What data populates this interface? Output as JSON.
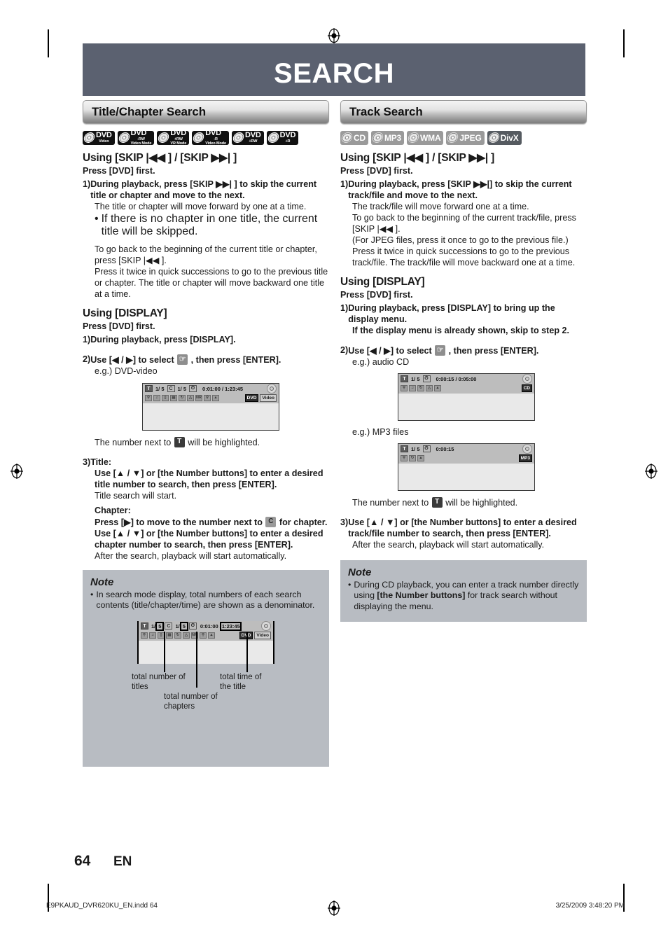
{
  "page": {
    "banner_title": "SEARCH",
    "page_number": "64",
    "language_code": "EN",
    "footer_file": "E9PKAUD_DVR620KU_EN.indd   64",
    "footer_date": "3/25/2009   3:48:20 PM",
    "banner_color": "#5b6170",
    "note_bg_color": "#b8bcc2"
  },
  "left": {
    "section_title": "Title/Chapter Search",
    "badges": [
      {
        "main": "DVD",
        "sub": "Video",
        "sub2": "",
        "style": "dark"
      },
      {
        "main": "DVD",
        "sub": "-RW",
        "sub2": "Video Mode",
        "style": "dark"
      },
      {
        "main": "DVD",
        "sub": "+RW",
        "sub2": "VR Mode",
        "style": "dark"
      },
      {
        "main": "DVD",
        "sub": "-R",
        "sub2": "Video Mode",
        "style": "dark"
      },
      {
        "main": "DVD",
        "sub": "+RW",
        "sub2": "",
        "style": "dark"
      },
      {
        "main": "DVD",
        "sub": "+R",
        "sub2": "",
        "style": "dark"
      }
    ],
    "skip_heading": "Using [SKIP |◀◀ ] / [SKIP ▶▶| ]",
    "skip_press_first": "Press [DVD] first.",
    "skip_step1_num": "1)",
    "skip_step1_text": "During playback, press [SKIP ▶▶| ] to skip the current title or chapter and move to the next.",
    "skip_step1_line2": "The title or chapter will move forward by one at a time.",
    "skip_step1_bullet": "If there is no chapter in one title, the current title will be skipped.",
    "skip_para1": "To go back to the beginning of the current title or chapter, press [SKIP |◀◀ ].",
    "skip_para2": "Press it twice in quick successions to go to the previous title or chapter. The title or chapter will move backward one title at a time.",
    "display_heading": "Using [DISPLAY]",
    "display_press_first": "Press [DVD] first.",
    "display_step1_num": "1)",
    "display_step1_text": "During playback, press [DISPLAY].",
    "display_step2_num": "2)",
    "display_step2_pre": "Use [◀ / ▶] to select",
    "display_step2_post": ", then press [ENTER].",
    "display_step2_eg": "e.g.) DVD-video",
    "highlight_pre": "The number next to",
    "highlight_post": "will be highlighted.",
    "step3_num": "3)",
    "step3_title_label": "Title:",
    "step3_title_text": "Use [▲ / ▼] or [the Number buttons] to enter a desired title number to search, then press [ENTER].",
    "step3_title_note": "Title search will start.",
    "step3_chapter_label": "Chapter:",
    "step3_chapter_pre": "Press [▶] to move to the number next to",
    "step3_chapter_post": "for chapter.",
    "step3_chapter_text": "Use [▲ / ▼] or [the Number buttons] to enter a desired chapter number to search, then press [ENTER].",
    "step3_after": "After the search, playback will start automatically.",
    "note_title": "Note",
    "note_item": "In search mode display, total numbers of each search contents (title/chapter/time) are shown as a denominator.",
    "callout_titles": "total number of titles",
    "callout_chapters": "total number of chapters",
    "callout_time": "total time of the title"
  },
  "right": {
    "section_title": "Track Search",
    "badges": [
      {
        "main": "CD",
        "style": "gray"
      },
      {
        "main": "MP3",
        "style": "gray"
      },
      {
        "main": "WMA",
        "style": "gray"
      },
      {
        "main": "JPEG",
        "style": "gray"
      },
      {
        "main": "DivX",
        "style": "dgray"
      }
    ],
    "skip_heading": "Using [SKIP |◀◀ ] / [SKIP ▶▶| ]",
    "skip_press_first": "Press [DVD] first.",
    "skip_step1_num": "1)",
    "skip_step1_text": "During playback, press [SKIP ▶▶|] to skip the current track/file and move to the next.",
    "skip_line2": "The track/file will move forward one at a time.",
    "skip_line3": "To go back to the beginning of the current track/file, press [SKIP |◀◀ ].",
    "skip_line4": "(For JPEG files, press it once to go to the previous file.)",
    "skip_line5": "Press it twice in quick successions to go to the previous track/file. The track/file will move backward one at a time.",
    "display_heading": "Using [DISPLAY]",
    "display_press_first": "Press [DVD] first.",
    "display_step1_num": "1)",
    "display_step1_text": "During playback, press [DISPLAY] to bring up the display menu.",
    "display_step1_text2": "If the display menu is already shown, skip to step 2.",
    "display_step2_num": "2)",
    "display_step2_pre": "Use [◀ / ▶] to select",
    "display_step2_post": ", then press [ENTER].",
    "display_step2_eg": "e.g.) audio CD",
    "display_step2_eg2": "e.g.) MP3 files",
    "highlight_pre": "The number next to",
    "highlight_post": "will be highlighted.",
    "step3_num": "3)",
    "step3_text": "Use [▲ / ▼] or [the Number buttons] to enter a desired track/file number to search, then press [ENTER].",
    "step3_after": "After the search, playback will start automatically.",
    "note_title": "Note",
    "note_item_pre": "During CD playback, you can enter a track number directly using",
    "note_item_bold": "[the Number buttons]",
    "note_item_post": "for track search without displaying the menu."
  },
  "osd": {
    "dvd_video": {
      "title_tag": "T",
      "title_val": "1/  5",
      "chapter_tag": "C",
      "chapter_val": "1/  5",
      "time_tag": "clock-icon",
      "time_val": "0:01:00 / 1:23:45",
      "format_tags": [
        "DVD",
        "Video"
      ],
      "icons": [
        "search-icon",
        "audio-icon",
        "subtitle-icon",
        "angle-icon",
        "repeat-icon",
        "surround-icon",
        "NR",
        "zoom-icon",
        "marker-icon"
      ]
    },
    "audio_cd": {
      "title_tag": "T",
      "title_val": "1/  5",
      "time_tag": "clock-icon",
      "time_val": "0:00:15 / 0:05:00",
      "format_tags": [
        "CD"
      ],
      "icons": [
        "search-icon",
        "audio-icon",
        "repeat-icon",
        "surround-icon",
        "marker-icon"
      ]
    },
    "mp3": {
      "title_tag": "T",
      "title_val": "1/  5",
      "time_tag": "clock-icon",
      "time_val": "0:00:15",
      "format_tags": [
        "MP3"
      ],
      "icons": [
        "search-icon",
        "repeat-icon",
        "marker-icon"
      ]
    },
    "callout": {
      "title_tag": "T",
      "title_num": "1/",
      "title_total": "5",
      "chapter_tag": "C",
      "chapter_num": "1/",
      "chapter_total": "5",
      "time_tag": "clock-icon",
      "time_cur": "0:01:00 /",
      "time_total": "1:23:45",
      "format_tags": [
        "DVD",
        "Video"
      ]
    }
  }
}
